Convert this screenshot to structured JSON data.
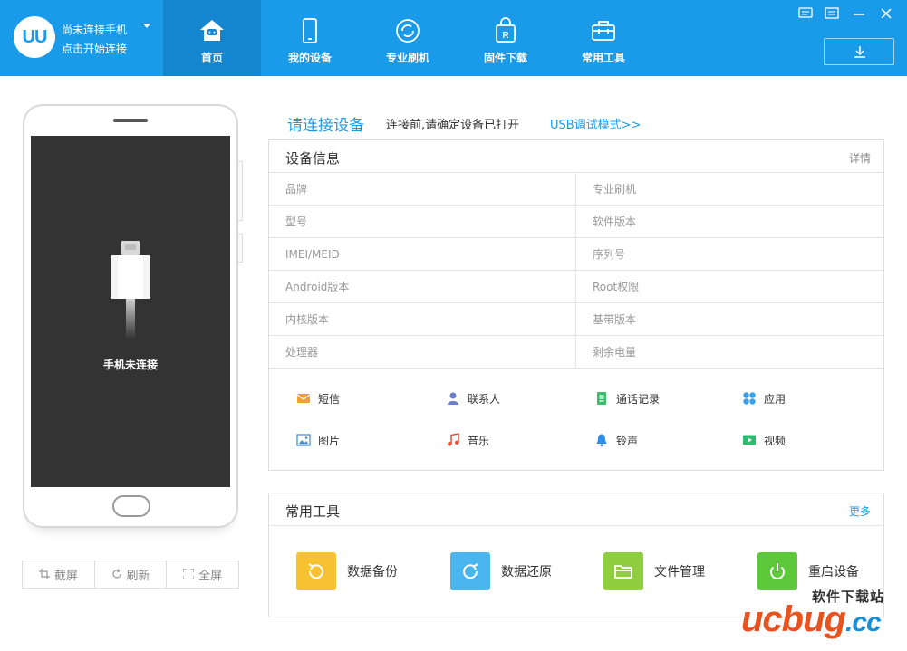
{
  "header": {
    "logo_text": "UU",
    "connection_title": "尚未连接手机",
    "connection_sub": "点击开始连接",
    "tabs": [
      {
        "label": "首页",
        "icon": "home-icon",
        "active": true
      },
      {
        "label": "我的设备",
        "icon": "phone-icon",
        "active": false
      },
      {
        "label": "专业刷机",
        "icon": "flash-icon",
        "active": false
      },
      {
        "label": "固件下载",
        "icon": "firmware-bag-icon",
        "active": false
      },
      {
        "label": "常用工具",
        "icon": "toolbox-icon",
        "active": false
      }
    ],
    "accent_color": "#1a9be9"
  },
  "phone": {
    "status": "手机未连接",
    "actions": [
      "截屏",
      "刷新",
      "全屏"
    ]
  },
  "connect": {
    "title": "请连接设备",
    "hint": "连接前,请确定设备已打开",
    "link": "USB调试模式>>"
  },
  "device_info": {
    "title": "设备信息",
    "more": "详情",
    "rows": [
      {
        "left": "品牌",
        "right": "专业刷机"
      },
      {
        "left": "型号",
        "right": "软件版本"
      },
      {
        "left": "IMEI/MEID",
        "right": "序列号"
      },
      {
        "left": "Android版本",
        "right": "Root权限"
      },
      {
        "left": "内核版本",
        "right": "基带版本"
      },
      {
        "left": "处理器",
        "right": "剩余电量"
      }
    ],
    "categories": [
      {
        "label": "短信",
        "icon": "sms-icon",
        "color": "#f0a030"
      },
      {
        "label": "联系人",
        "icon": "contact-icon",
        "color": "#6c7ccf"
      },
      {
        "label": "通话记录",
        "icon": "call-log-icon",
        "color": "#3bbf6a"
      },
      {
        "label": "应用",
        "icon": "apps-icon",
        "color": "#3aa0e8"
      },
      {
        "label": "图片",
        "icon": "picture-icon",
        "color": "#4a90d9"
      },
      {
        "label": "音乐",
        "icon": "music-icon",
        "color": "#e8503c"
      },
      {
        "label": "铃声",
        "icon": "bell-icon",
        "color": "#2e8ee8"
      },
      {
        "label": "视频",
        "icon": "video-icon",
        "color": "#2ebd6e"
      }
    ]
  },
  "tools": {
    "title": "常用工具",
    "more": "更多",
    "items": [
      {
        "label": "数据备份",
        "icon": "backup-icon",
        "color": "#f7c232"
      },
      {
        "label": "数据还原",
        "icon": "restore-icon",
        "color": "#4ab5ef"
      },
      {
        "label": "文件管理",
        "icon": "folder-icon",
        "color": "#8fce3e"
      },
      {
        "label": "重启设备",
        "icon": "power-icon",
        "color": "#5cc83a"
      }
    ]
  },
  "watermark": {
    "top": "软件下载站",
    "brand": "ucbug",
    "suffix": ".cc"
  }
}
